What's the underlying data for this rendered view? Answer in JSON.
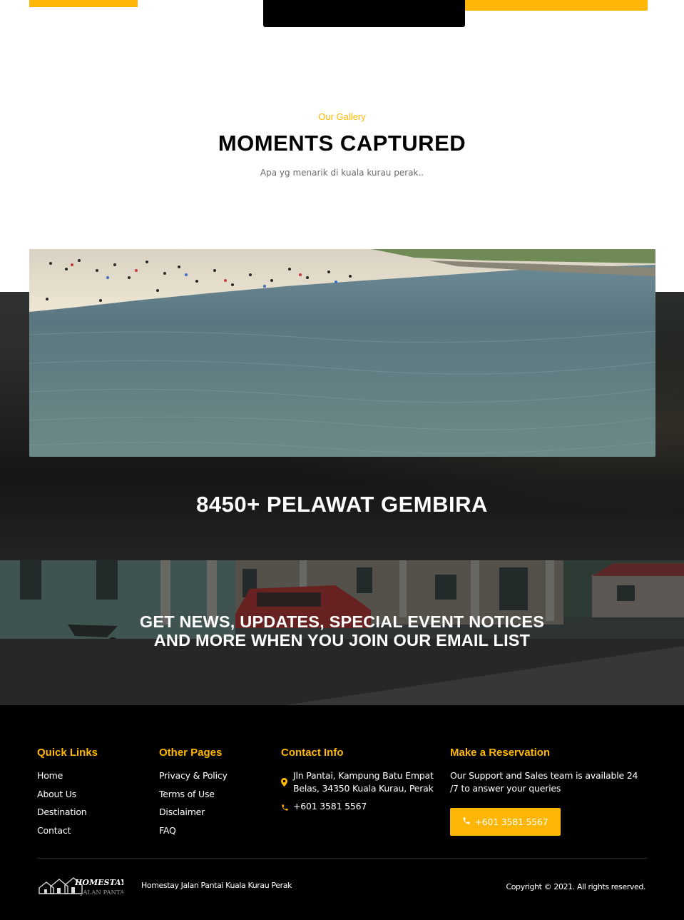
{
  "gallery": {
    "kicker": "Our Gallery",
    "title": "MOMENTS CAPTURED",
    "subtitle": "Apa yg menarik di kuala kurau perak.."
  },
  "stats": {
    "visitors_text": "8450+ PELAWAT GEMBIRA"
  },
  "newsletter": {
    "line1": "GET NEWS, UPDATES, SPECIAL EVENT NOTICES",
    "line2": "AND MORE WHEN YOU JOIN OUR EMAIL LIST"
  },
  "footer": {
    "quick_links": {
      "title": "Quick Links",
      "items": [
        "Home",
        "About Us",
        "Destination",
        "Contact"
      ]
    },
    "other_pages": {
      "title": "Other Pages",
      "items": [
        "Privacy & Policy",
        "Terms of Use",
        "Disclaimer",
        "FAQ"
      ]
    },
    "contact_info": {
      "title": "Contact Info",
      "address_line1": "Jln Pantai, Kampung Batu Empat",
      "address_line2": "Belas, 34350 Kuala Kurau, Perak",
      "phone": "+601 3581 5567"
    },
    "reservation": {
      "title": "Make a Reservation",
      "text": "Our Support and Sales team is available 24 /7 to answer your queries",
      "button_label": "+601 3581 5567"
    },
    "logo_text": "HOMESTAY",
    "logo_subtext": "JALAN PANTAI",
    "site_name": "Homestay Jalan Pantai Kuala Kurau Perak",
    "copyright": "Copyright © 2021. All rights reserved."
  },
  "colors": {
    "accent": "#FFB606",
    "footer_bg": "#000000"
  },
  "icons": {
    "location": "map-pin-icon",
    "phone": "phone-icon"
  }
}
